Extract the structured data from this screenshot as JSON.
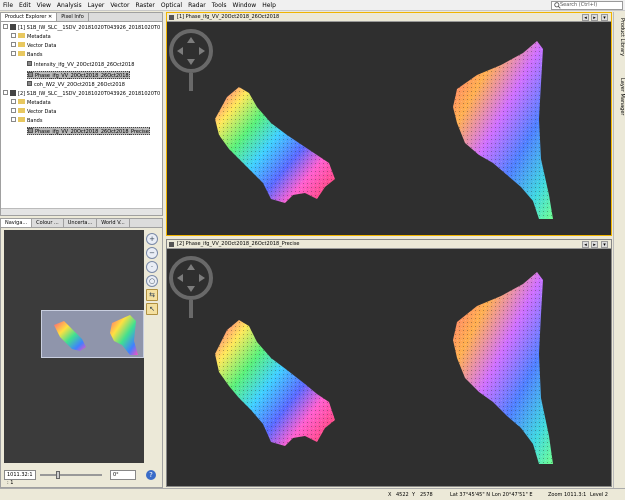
{
  "menu": [
    "File",
    "Edit",
    "View",
    "Analysis",
    "Layer",
    "Vector",
    "Raster",
    "Optical",
    "Radar",
    "Tools",
    "Window",
    "Help"
  ],
  "search": {
    "placeholder": "Search (Ctrl+I)"
  },
  "left_top_tabs": {
    "product_explorer": "Product Explorer",
    "pixel_info": "Pixel Info"
  },
  "tree": {
    "p1": "[1] S1B_IW_SLC__1SDV_20181020T043926_20181020T0",
    "p1_metadata": "Metadata",
    "p1_vector": "Vector Data",
    "p1_bands": "Bands",
    "p1_band1": "Intensity_ifg_VV_20Oct2018_26Oct2018",
    "p1_band2": "Phase_ifg_VV_20Oct2018_26Oct2018",
    "p1_band3": "coh_IW2_VV_20Oct2018_26Oct2018",
    "p2": "[2] S1B_IW_SLC__1SDV_20181020T043926_20181020T0",
    "p2_metadata": "Metadata",
    "p2_vector": "Vector Data",
    "p2_bands": "Bands",
    "p2_band1": "Phase_ifg_VV_20Oct2018_26Oct2018_Precise"
  },
  "left_bot_tabs": {
    "navigation": "Naviga...",
    "colour": "Colour ...",
    "uncertainty": "Uncerta...",
    "world": "World V..."
  },
  "nav": {
    "zoom_value": "1011.32:1 : 1",
    "angle_value": "0°"
  },
  "views": {
    "view1_title": "[1] Phase_ifg_VV_20Oct2018_26Oct2018",
    "view2_title": "[2] Phase_ifg_VV_20Oct2018_26Oct2018_Precise"
  },
  "right_dock": {
    "product_library": "Product Library",
    "layer_manager": "Layer Manager"
  },
  "status": {
    "x": "X",
    "x_val": "4522",
    "y": "Y",
    "y_val": "2578",
    "lat": "Lat 37°45'45\" N",
    "lon": "Lon 20°47'51\" E",
    "zoom": "Zoom 1011.3:1",
    "level": "Level 2"
  },
  "colors": {
    "accent": "#f0b400",
    "canvas": "#2f2f2f"
  }
}
